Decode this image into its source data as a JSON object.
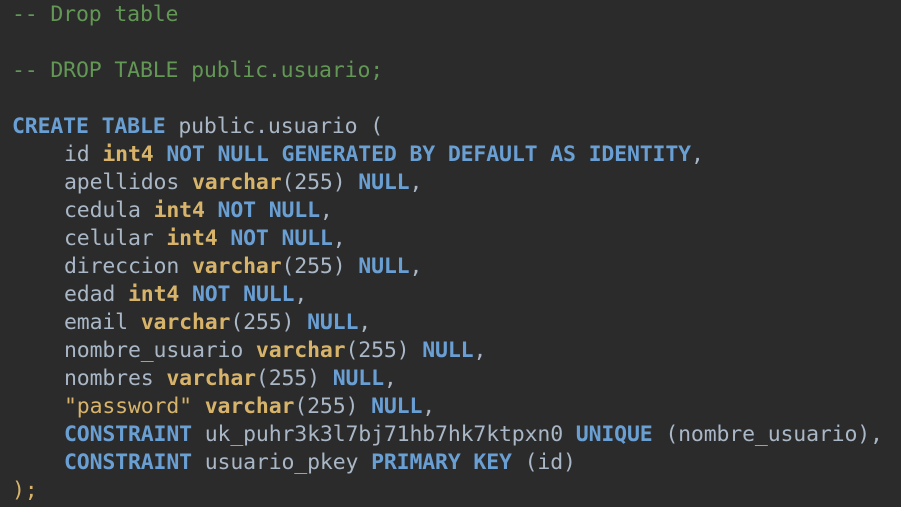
{
  "editor": {
    "background": "#2b2b2b",
    "colors": {
      "comment": "#629755",
      "keyword": "#6a9fd4",
      "type": "#d8b46a",
      "identifier": "#a9b7c6"
    },
    "lines": [
      {
        "indent": false,
        "tokens": [
          {
            "t": "-- Drop table",
            "c": "comment"
          }
        ]
      },
      {
        "indent": false,
        "tokens": []
      },
      {
        "indent": false,
        "tokens": [
          {
            "t": "-- DROP TABLE public.usuario;",
            "c": "comment"
          }
        ]
      },
      {
        "indent": false,
        "tokens": []
      },
      {
        "indent": false,
        "tokens": [
          {
            "t": "CREATE",
            "c": "kw"
          },
          {
            "t": " ",
            "c": "punct"
          },
          {
            "t": "TABLE",
            "c": "kw"
          },
          {
            "t": " public.usuario (",
            "c": "ident"
          }
        ]
      },
      {
        "indent": true,
        "tokens": [
          {
            "t": "id ",
            "c": "ident"
          },
          {
            "t": "int4",
            "c": "type"
          },
          {
            "t": " ",
            "c": "punct"
          },
          {
            "t": "NOT NULL GENERATED BY DEFAULT AS IDENTITY",
            "c": "kw"
          },
          {
            "t": ",",
            "c": "punct"
          }
        ]
      },
      {
        "indent": true,
        "tokens": [
          {
            "t": "apellidos ",
            "c": "ident"
          },
          {
            "t": "varchar",
            "c": "type"
          },
          {
            "t": "(255) ",
            "c": "num"
          },
          {
            "t": "NULL",
            "c": "kw"
          },
          {
            "t": ",",
            "c": "punct"
          }
        ]
      },
      {
        "indent": true,
        "tokens": [
          {
            "t": "cedula ",
            "c": "ident"
          },
          {
            "t": "int4",
            "c": "type"
          },
          {
            "t": " ",
            "c": "punct"
          },
          {
            "t": "NOT NULL",
            "c": "kw"
          },
          {
            "t": ",",
            "c": "punct"
          }
        ]
      },
      {
        "indent": true,
        "tokens": [
          {
            "t": "celular ",
            "c": "ident"
          },
          {
            "t": "int4",
            "c": "type"
          },
          {
            "t": " ",
            "c": "punct"
          },
          {
            "t": "NOT NULL",
            "c": "kw"
          },
          {
            "t": ",",
            "c": "punct"
          }
        ]
      },
      {
        "indent": true,
        "tokens": [
          {
            "t": "direccion ",
            "c": "ident"
          },
          {
            "t": "varchar",
            "c": "type"
          },
          {
            "t": "(255) ",
            "c": "num"
          },
          {
            "t": "NULL",
            "c": "kw"
          },
          {
            "t": ",",
            "c": "punct"
          }
        ]
      },
      {
        "indent": true,
        "tokens": [
          {
            "t": "edad ",
            "c": "ident"
          },
          {
            "t": "int4",
            "c": "type"
          },
          {
            "t": " ",
            "c": "punct"
          },
          {
            "t": "NOT NULL",
            "c": "kw"
          },
          {
            "t": ",",
            "c": "punct"
          }
        ]
      },
      {
        "indent": true,
        "tokens": [
          {
            "t": "email ",
            "c": "ident"
          },
          {
            "t": "varchar",
            "c": "type"
          },
          {
            "t": "(255) ",
            "c": "num"
          },
          {
            "t": "NULL",
            "c": "kw"
          },
          {
            "t": ",",
            "c": "punct"
          }
        ]
      },
      {
        "indent": true,
        "tokens": [
          {
            "t": "nombre_usuario ",
            "c": "ident"
          },
          {
            "t": "varchar",
            "c": "type"
          },
          {
            "t": "(255) ",
            "c": "num"
          },
          {
            "t": "NULL",
            "c": "kw"
          },
          {
            "t": ",",
            "c": "punct"
          }
        ]
      },
      {
        "indent": true,
        "tokens": [
          {
            "t": "nombres ",
            "c": "ident"
          },
          {
            "t": "varchar",
            "c": "type"
          },
          {
            "t": "(255) ",
            "c": "num"
          },
          {
            "t": "NULL",
            "c": "kw"
          },
          {
            "t": ",",
            "c": "punct"
          }
        ]
      },
      {
        "indent": true,
        "tokens": [
          {
            "t": "\"password\"",
            "c": "str"
          },
          {
            "t": " ",
            "c": "punct"
          },
          {
            "t": "varchar",
            "c": "type"
          },
          {
            "t": "(255) ",
            "c": "num"
          },
          {
            "t": "NULL",
            "c": "kw"
          },
          {
            "t": ",",
            "c": "punct"
          }
        ]
      },
      {
        "indent": true,
        "tokens": [
          {
            "t": "CONSTRAINT",
            "c": "kw"
          },
          {
            "t": " uk_puhr3k3l7bj71hb7hk7ktpxn0 ",
            "c": "ident"
          },
          {
            "t": "UNIQUE",
            "c": "kw"
          },
          {
            "t": " (nombre_usuario),",
            "c": "ident"
          }
        ]
      },
      {
        "indent": true,
        "tokens": [
          {
            "t": "CONSTRAINT",
            "c": "kw"
          },
          {
            "t": " usuario_pkey ",
            "c": "ident"
          },
          {
            "t": "PRIMARY KEY",
            "c": "kw"
          },
          {
            "t": " (id)",
            "c": "ident"
          }
        ]
      },
      {
        "indent": false,
        "tokens": [
          {
            "t": ");",
            "c": "closing"
          }
        ]
      }
    ]
  }
}
